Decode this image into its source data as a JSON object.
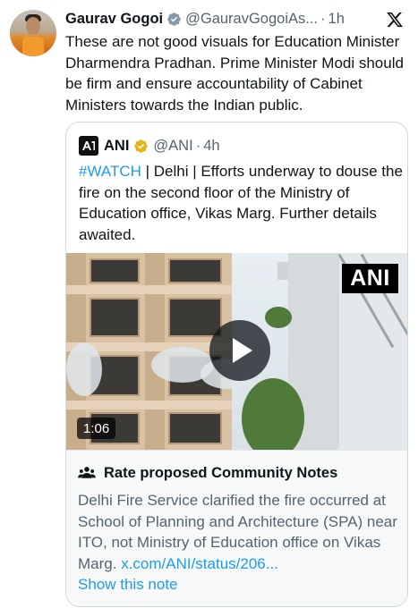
{
  "post": {
    "display_name": "Gaurav Gogoi",
    "handle": "@GauravGogoiAs...",
    "separator": "·",
    "time": "1h",
    "text": "These are not good visuals for Education Minister Dharmendra Pradhan. Prime Minister Modi should be firm and ensure accountability of Cabinet Ministers towards the Indian public.",
    "verified_color": "#829aab"
  },
  "quote": {
    "display_name": "ANI",
    "handle": "@ANI",
    "separator": "·",
    "time": "4h",
    "hashtag": "#WATCH",
    "text_rest": " | Delhi | Efforts underway to douse the fire on the second floor of the Ministry of Education office, Vikas Marg. Further details awaited.",
    "verified_color": "#e2b719",
    "video": {
      "watermark": "ANI",
      "duration": "1:06"
    }
  },
  "community_notes": {
    "title": "Rate proposed Community Notes",
    "text": "Delhi Fire Service clarified the fire occurred at School of Planning and Architecture (SPA) near ITO, not Ministry of Education office on Vikas Marg. ",
    "link": "x.com/ANI/status/206...",
    "show_label": "Show this note"
  },
  "icons": {
    "close": "x-logo-icon",
    "play": "play-icon",
    "community": "people-icon"
  },
  "colors": {
    "link": "#1d9bf0",
    "secondary_text": "#536471",
    "primary_text": "#0f1419"
  }
}
